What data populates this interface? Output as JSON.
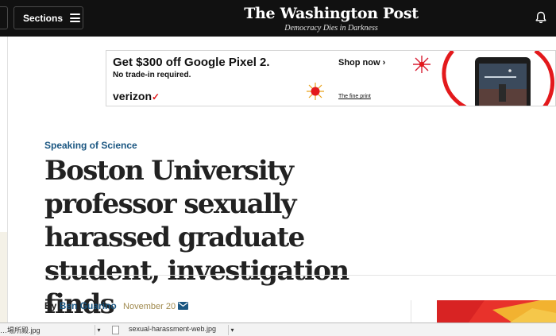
{
  "nav": {
    "sections_label": "Sections",
    "logo": "The Washington Post",
    "tagline": "Democracy Dies in Darkness"
  },
  "ad": {
    "headline": "Get $300 off Google Pixel 2.",
    "subline": "No trade-in required.",
    "cta": "Shop now",
    "brand": "verizon",
    "fine_print": "The fine print"
  },
  "article": {
    "kicker": "Speaking of Science",
    "headline": "Boston University professor sexually harassed graduate student, investigation finds",
    "byline_prefix": "By",
    "author": "Ben Guarino",
    "date": "November 20"
  },
  "downloads": [
    {
      "filename": "…場所殿.jpg"
    },
    {
      "filename": "sexual-harassment-web.jpg"
    }
  ],
  "icons": [
    "hamburger-icon",
    "bell-icon",
    "mail-icon",
    "chevron-right-icon",
    "file-icon",
    "chevron-down-icon"
  ],
  "colors": {
    "topbar": "#111111",
    "link_blue": "#1a5681",
    "date_gold": "#a08a4e",
    "ad_red": "#e3191c"
  }
}
